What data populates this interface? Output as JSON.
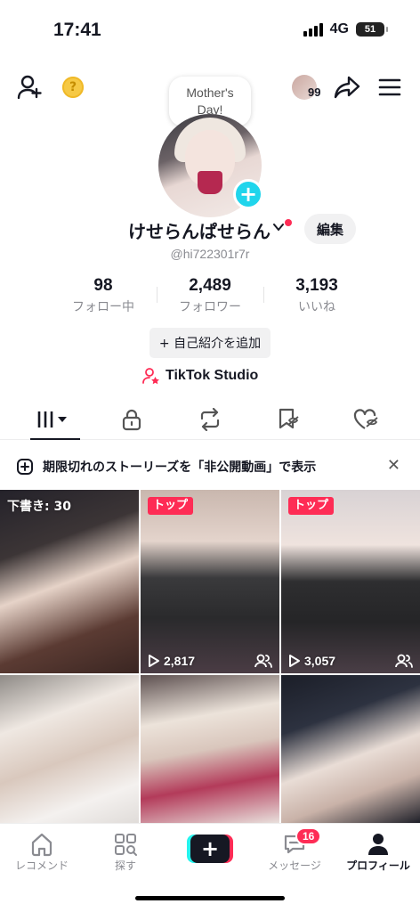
{
  "status_bar": {
    "time": "17:41",
    "network": "4G",
    "battery": "51"
  },
  "top_bar": {
    "coin_glyph": "?",
    "notification_count": "99"
  },
  "bubble": {
    "line1": "Mother's",
    "line2": "Day!"
  },
  "profile": {
    "display_name": "けせらんぱせらん",
    "edit_label": "編集",
    "handle": "@hi722301r7r",
    "add_bio_label": "+ 自己紹介を追加",
    "studio_label": "TikTok Studio"
  },
  "stats": [
    {
      "value": "98",
      "label": "フォロー中"
    },
    {
      "value": "2,489",
      "label": "フォロワー"
    },
    {
      "value": "3,193",
      "label": "いいね"
    }
  ],
  "notice": {
    "text": "期限切れのストーリーズを「非公開動画」で表示",
    "close": "✕"
  },
  "grid": [
    {
      "kind": "draft",
      "label": "下書き: 30"
    },
    {
      "kind": "top",
      "label": "トップ",
      "views": "2,817"
    },
    {
      "kind": "top",
      "label": "トップ",
      "views": "3,057"
    },
    {
      "kind": "plain"
    },
    {
      "kind": "plain"
    },
    {
      "kind": "plain"
    }
  ],
  "nav": {
    "home": "レコメンド",
    "discover": "探す",
    "create": "+",
    "inbox": "メッセージ",
    "inbox_badge": "16",
    "profile": "プロフィール"
  },
  "colors": {
    "accent": "#fe2c55",
    "cyan": "#20d5ec"
  }
}
